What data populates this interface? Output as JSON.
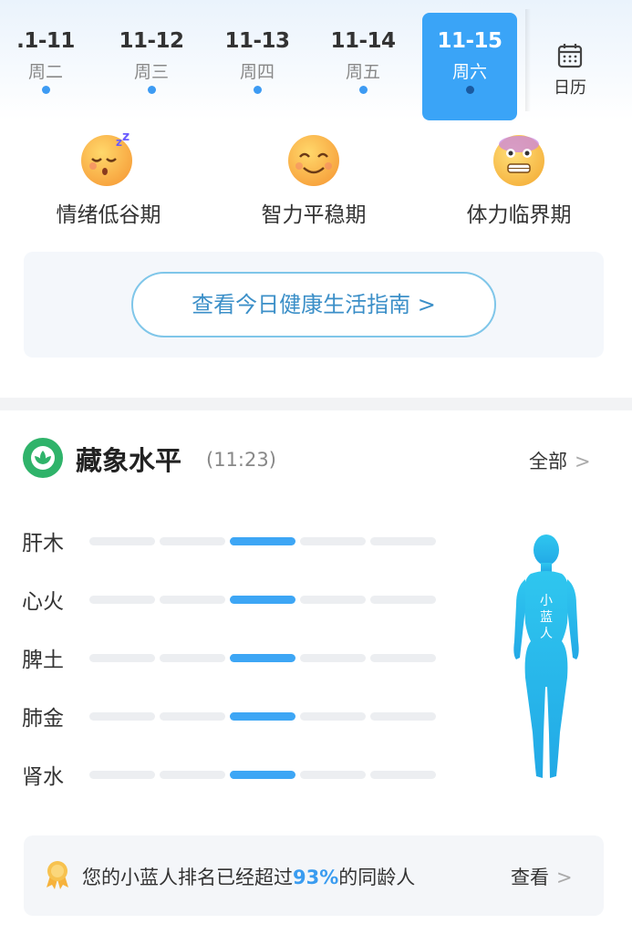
{
  "dates": [
    {
      "date": ".1-11",
      "weekday": "周二"
    },
    {
      "date": "11-12",
      "weekday": "周三"
    },
    {
      "date": "11-13",
      "weekday": "周四"
    },
    {
      "date": "11-14",
      "weekday": "周五"
    },
    {
      "date": "11-15",
      "weekday": "周六"
    }
  ],
  "calendar_label": "日历",
  "biorhythm": [
    {
      "label": "情绪低谷期",
      "icon": "sleepy-face-icon"
    },
    {
      "label": "智力平稳期",
      "icon": "smiling-face-icon"
    },
    {
      "label": "体力临界期",
      "icon": "grimacing-face-icon"
    }
  ],
  "guide_button": "查看今日健康生活指南 >",
  "zangxiang": {
    "title": "藏象水平",
    "time": "(11:23)",
    "all_label": "全部",
    "organs": [
      {
        "name": "肝木",
        "level": 3
      },
      {
        "name": "心火",
        "level": 3
      },
      {
        "name": "脾土",
        "level": 3
      },
      {
        "name": "肺金",
        "level": 3
      },
      {
        "name": "肾水",
        "level": 3
      }
    ],
    "levels_total": 5,
    "figure_label": "小蓝人"
  },
  "rank": {
    "prefix": "您的小蓝人排名已经超过",
    "percent": "93%",
    "suffix": "的同龄人",
    "view_label": "查看"
  },
  "colors": {
    "accent": "#3aa4f7",
    "active_segment": "#3da6f5",
    "logo_green": "#2fb36a"
  }
}
